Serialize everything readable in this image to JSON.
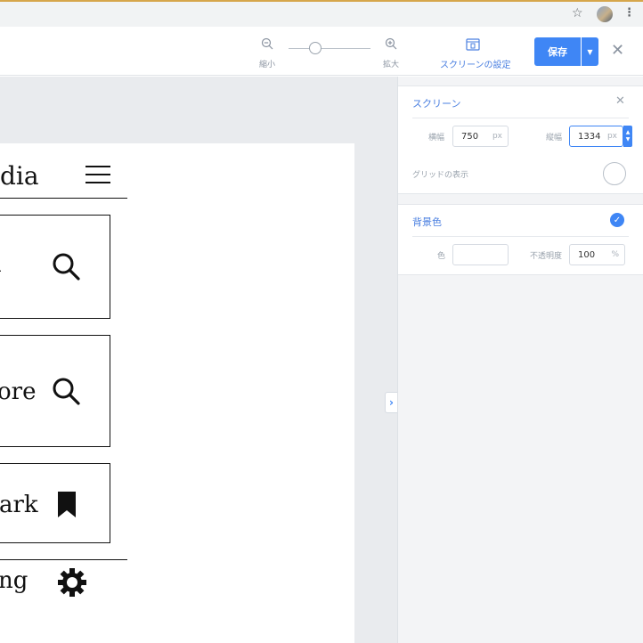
{
  "toolbar": {
    "zoom_out_label": "縮小",
    "zoom_in_label": "拡大",
    "screen_settings_label": "スクリーンの設定",
    "save_label": "保存"
  },
  "canvas": {
    "title": "dia",
    "cards": [
      {
        "label": "d",
        "icon": "search-icon"
      },
      {
        "label": "ore",
        "icon": "search-icon"
      },
      {
        "label": "ark",
        "icon": "bookmark-icon"
      }
    ],
    "setting_label": "ng",
    "setting_icon": "gear-icon"
  },
  "panel": {
    "screen": {
      "title": "スクリーン",
      "width_label": "横幅",
      "width_value": "750",
      "width_unit": "px",
      "height_label": "縦幅",
      "height_value": "1334",
      "height_unit": "px",
      "grid_label": "グリッドの表示"
    },
    "background": {
      "title": "背景色",
      "color_label": "色",
      "color_value": "",
      "opacity_label": "不透明度",
      "opacity_value": "100",
      "opacity_unit": "%"
    }
  },
  "colors": {
    "accent": "#3f86f5",
    "chrome_border": "#d6a64b",
    "canvas_bg": "#e9ebee"
  }
}
